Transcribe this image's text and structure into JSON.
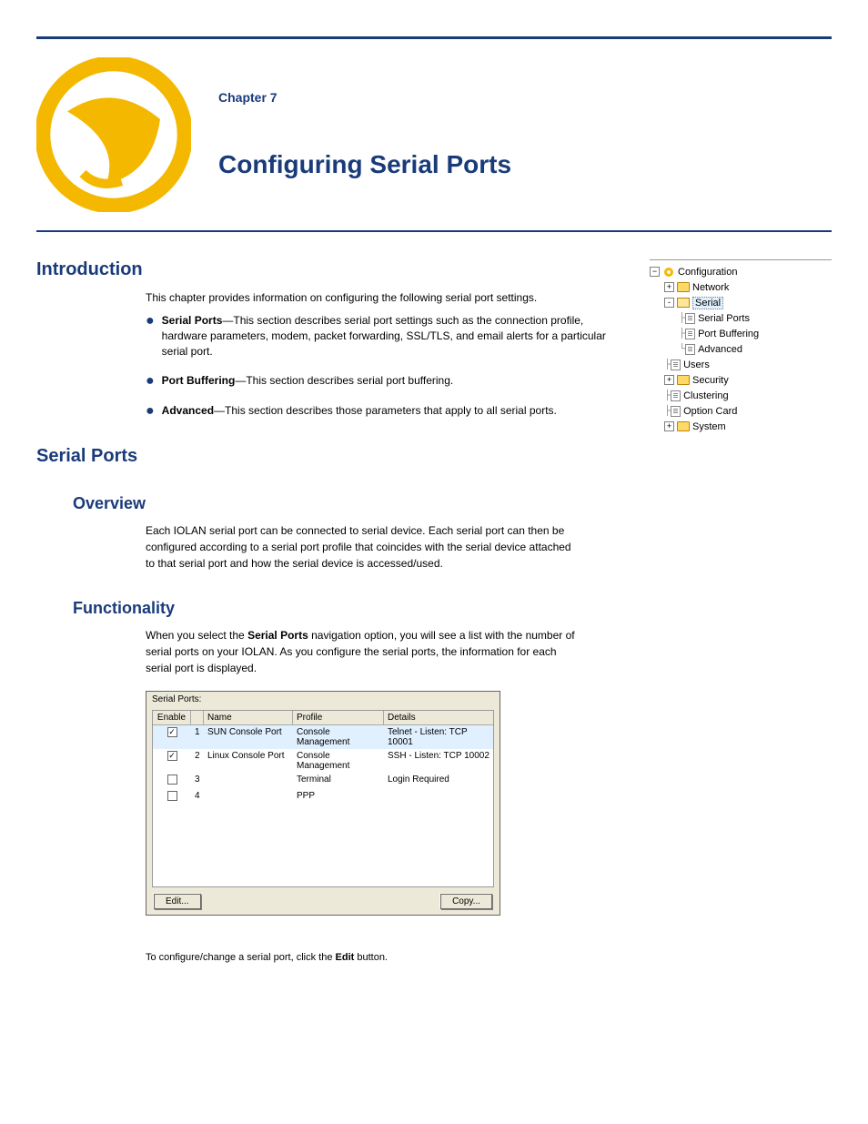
{
  "header": {
    "chapter_num": "Chapter 7",
    "title": "Configuring Serial Ports"
  },
  "intro": {
    "section_title": "Introduction",
    "lead": "This chapter provides information on configuring the following serial port settings.",
    "bullets": [
      {
        "bold": "Serial Ports",
        "rest": "—This section describes serial port settings such as the connection profile, hardware parameters, modem, packet forwarding, SSL/TLS, and email alerts for a particular serial port."
      },
      {
        "bold": "Port Buffering",
        "rest": "—This section describes serial port buffering."
      },
      {
        "bold": "Advanced",
        "rest": "—This section describes those parameters that apply to all serial ports."
      }
    ]
  },
  "tree": {
    "root": "Configuration",
    "items": [
      {
        "label": "Network",
        "type": "folder",
        "expand": "+"
      },
      {
        "label": "Serial",
        "type": "folder-open",
        "expand": "-",
        "selected": true,
        "children": [
          {
            "label": "Serial Ports",
            "type": "doc"
          },
          {
            "label": "Port Buffering",
            "type": "doc"
          },
          {
            "label": "Advanced",
            "type": "doc"
          }
        ]
      },
      {
        "label": "Users",
        "type": "doc"
      },
      {
        "label": "Security",
        "type": "folder",
        "expand": "+"
      },
      {
        "label": "Clustering",
        "type": "doc"
      },
      {
        "label": "Option Card",
        "type": "doc"
      },
      {
        "label": "System",
        "type": "folder",
        "expand": "+"
      }
    ]
  },
  "serial_ports": {
    "section_title": "Serial Ports",
    "overview_title": "Overview",
    "overview_body": "Each IOLAN serial port can be connected to serial device. Each serial port can then be configured according to a serial port profile that coincides with the serial device attached to that serial port and how the serial device is accessed/used.",
    "func_title": "Functionality",
    "func_body1": "When you select the ",
    "func_bold": "Serial Ports",
    "func_body2": " navigation option, you will see a list with the number of serial ports on your IOLAN. As you configure the serial ports, the information for each serial port is displayed.",
    "panel": {
      "title": "Serial Ports:",
      "headers": {
        "enable": "Enable",
        "num": "",
        "name": "Name",
        "profile": "Profile",
        "details": "Details"
      },
      "rows": [
        {
          "enabled": true,
          "num": "1",
          "name": "SUN Console Port",
          "profile": "Console Management",
          "details": "Telnet - Listen: TCP 10001",
          "selected": true
        },
        {
          "enabled": true,
          "num": "2",
          "name": "Linux Console Port",
          "profile": "Console Management",
          "details": "SSH - Listen: TCP 10002"
        },
        {
          "enabled": false,
          "num": "3",
          "name": "",
          "profile": "Terminal",
          "details": "Login Required"
        },
        {
          "enabled": false,
          "num": "4",
          "name": "",
          "profile": "PPP",
          "details": ""
        }
      ],
      "buttons": {
        "edit": "Edit...",
        "copy": "Copy..."
      }
    }
  },
  "footer": {
    "text": "To configure/change a serial port, click the ",
    "bold": "Edit",
    "text2": " button."
  }
}
